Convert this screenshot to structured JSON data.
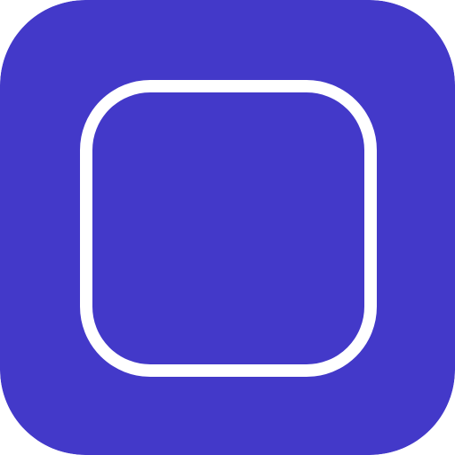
{
  "icon": {
    "name": "rounded-square-outline-icon",
    "colors": {
      "background": "#4339C9",
      "stroke": "#FFFFFF"
    }
  }
}
